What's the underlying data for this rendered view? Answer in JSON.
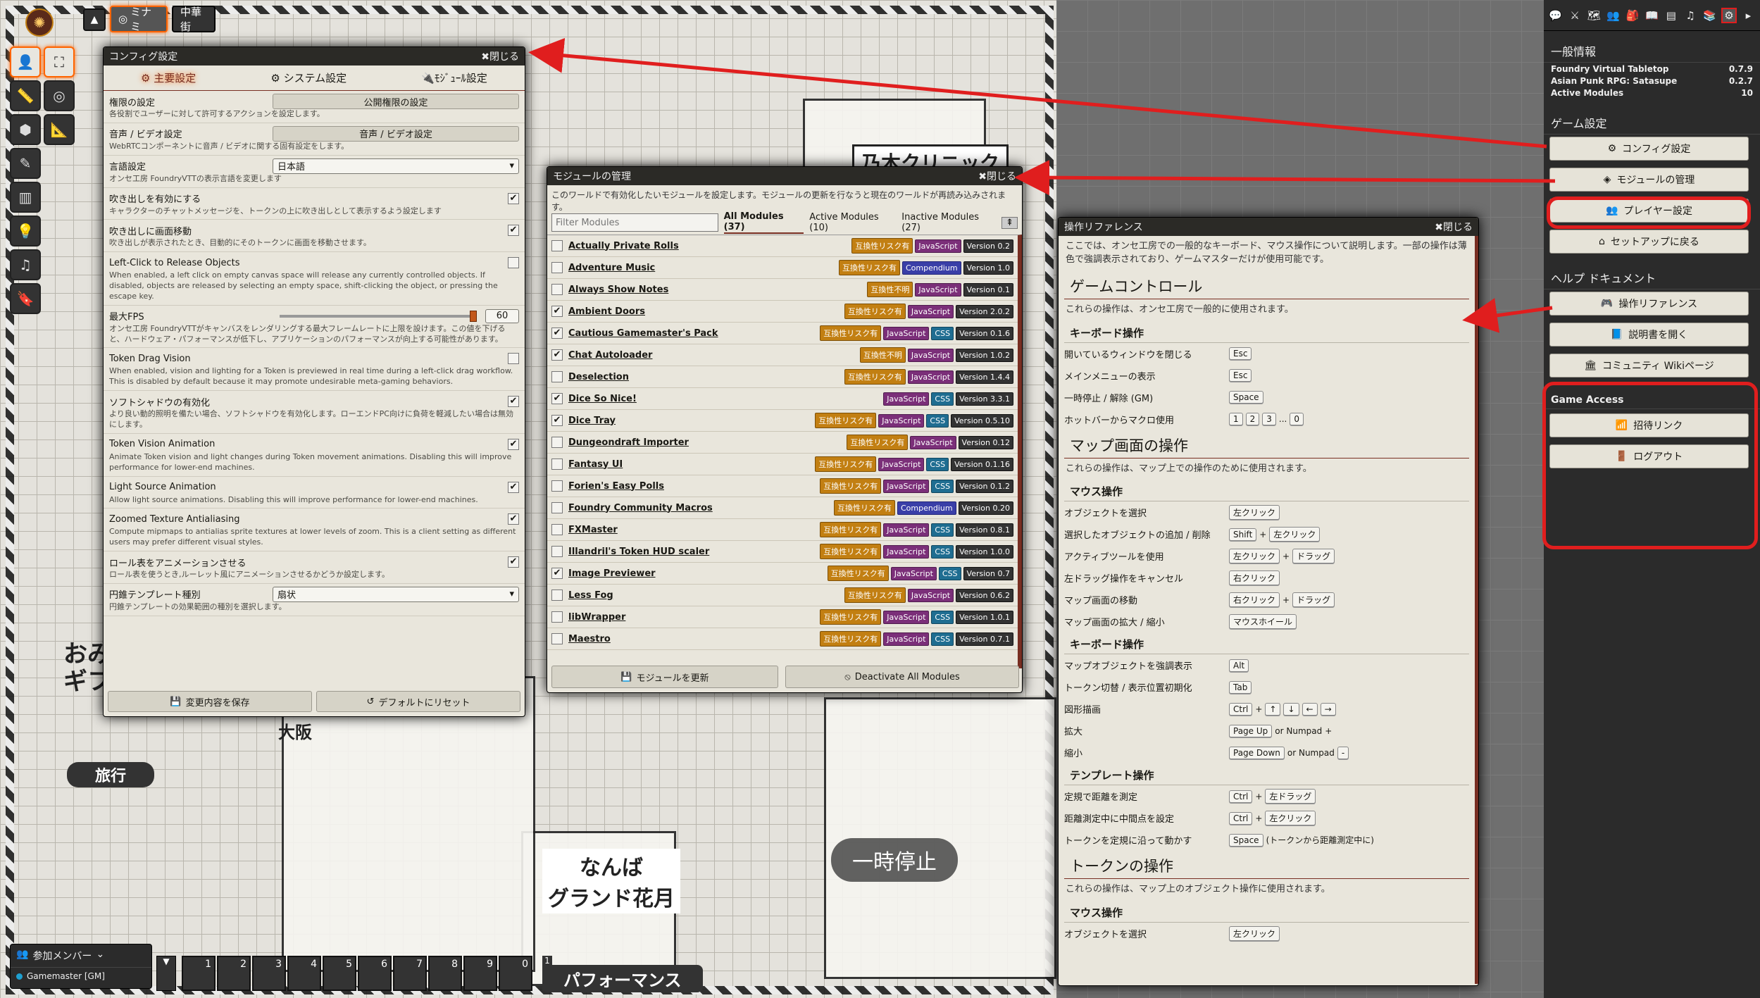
{
  "scene_nav": {
    "active_scene": "ミナミ",
    "other_scene": "中華街"
  },
  "map": {
    "labels": [
      "乃木クリニック",
      "なんば\nグランド花月",
      "旅行",
      "パフォーマンス",
      "大阪",
      "おみ\nギフ"
    ],
    "paused": "一時停止"
  },
  "config": {
    "title": "コンフィグ設定",
    "close": "閉じる",
    "tabs": [
      "主要設定",
      "システム設定",
      "ﾓｼﾞｭｰﾙ設定"
    ],
    "settings": [
      {
        "name": "権限の設定",
        "hint": "各役割でユーザーに対して許可するアクションを設定します。",
        "control": "button",
        "value": "公開権限の設定"
      },
      {
        "name": "音声 / ビデオ設定",
        "hint": "WebRTCコンポーネントに音声 / ビデオに関する固有設定をします。",
        "control": "button",
        "value": "音声 / ビデオ設定"
      },
      {
        "name": "言語設定",
        "hint": "オンセ工房 FoundryVTTの表示言語を変更します",
        "control": "select",
        "value": "日本語"
      },
      {
        "name": "吹き出しを有効にする",
        "hint": "キャラクターのチャットメッセージを、トークンの上に吹き出しとして表示するよう設定します",
        "control": "check",
        "checked": true
      },
      {
        "name": "吹き出しに画面移動",
        "hint": "吹き出しが表示されたとき、目動的にそのトークンに画面を移動させます。",
        "control": "check",
        "checked": true
      },
      {
        "name": "Left-Click to Release Objects",
        "hint": "When enabled, a left click on empty canvas space will release any currently controlled objects. If disabled, objects are released by selecting an empty space, shift-clicking the object, or pressing the escape key.",
        "control": "check",
        "checked": false
      },
      {
        "name": "最大FPS",
        "hint": "オンセ工房 FoundryVTTがキャンバスをレンダリングする最大フレームレートに上限を設けます。この値を下げると、ハードウェア・パフォーマンスが低下し、アプリケーションのパフォーマンスが向上する可能性があります。",
        "control": "range",
        "value": "60",
        "fraction": 1.0
      },
      {
        "name": "Token Drag Vision",
        "hint": "When enabled, vision and lighting for a Token is previewed in real time during a left-click drag workflow. This is disabled by default because it may promote undesirable meta-gaming behaviors.",
        "control": "check",
        "checked": false
      },
      {
        "name": "ソフトシャドウの有効化",
        "hint": "より良い動的照明を備たい場合、ソフトシャドウを有効化します。ローエンドPC向けに負荷を軽減したい場合は無効にします。",
        "control": "check",
        "checked": true
      },
      {
        "name": "Token Vision Animation",
        "hint": "Animate Token vision and light changes during Token movement animations. Disabling this will improve performance for lower-end machines.",
        "control": "check",
        "checked": true
      },
      {
        "name": "Light Source Animation",
        "hint": "Allow light source animations. Disabling this will improve performance for lower-end machines.",
        "control": "check",
        "checked": true
      },
      {
        "name": "Zoomed Texture Antialiasing",
        "hint": "Compute mipmaps to antialias sprite textures at lower levels of zoom. This is a client setting as different users may prefer different visual styles.",
        "control": "check",
        "checked": true
      },
      {
        "name": "ロール表をアニメーションさせる",
        "hint": "ロール表を使うとき,ルーレット風にアニメーションさせるかどうか設定します。",
        "control": "check",
        "checked": true
      },
      {
        "name": "円錐テンプレート種別",
        "hint": "円錐テンプレートの効果範囲の種別を選択します。",
        "control": "select",
        "value": "扇状"
      }
    ],
    "save": "変更内容を保存",
    "reset": "デフォルトにリセット"
  },
  "modules": {
    "title": "モジュールの管理",
    "close": "閉じる",
    "intro": "このワールドで有効化したいモジュールを設定します。モジュールの更新を行なうと現在のワールドが再読み込みされます。",
    "filter_placeholder": "Filter Modules",
    "tabs": [
      "All Modules (37)",
      "Active Modules (10)",
      "Inactive Modules (27)"
    ],
    "items": [
      {
        "name": "Actually Private Rolls",
        "checked": false,
        "tags": [
          "互換性リスク有",
          "JavaScript"
        ],
        "version": "Version 0.2"
      },
      {
        "name": "Adventure Music",
        "checked": false,
        "tags": [
          "互換性リスク有",
          "Compendium"
        ],
        "version": "Version 1.0"
      },
      {
        "name": "Always Show Notes",
        "checked": false,
        "tags": [
          "互換性不明",
          "JavaScript"
        ],
        "version": "Version 0.1"
      },
      {
        "name": "Ambient Doors",
        "checked": true,
        "tags": [
          "互換性リスク有",
          "JavaScript"
        ],
        "version": "Version 2.0.2"
      },
      {
        "name": "Cautious Gamemaster's Pack",
        "checked": true,
        "tags": [
          "互換性リスク有",
          "JavaScript",
          "CSS"
        ],
        "version": "Version 0.1.6"
      },
      {
        "name": "Chat Autoloader",
        "checked": true,
        "tags": [
          "互換性不明",
          "JavaScript"
        ],
        "version": "Version 1.0.2"
      },
      {
        "name": "Deselection",
        "checked": false,
        "tags": [
          "互換性リスク有",
          "JavaScript"
        ],
        "version": "Version 1.4.4"
      },
      {
        "name": "Dice So Nice!",
        "checked": true,
        "tags": [
          "JavaScript",
          "CSS"
        ],
        "version": "Version 3.3.1"
      },
      {
        "name": "Dice Tray",
        "checked": true,
        "tags": [
          "互換性リスク有",
          "JavaScript",
          "CSS"
        ],
        "version": "Version 0.5.10"
      },
      {
        "name": "Dungeondraft Importer",
        "checked": false,
        "tags": [
          "互換性リスク有",
          "JavaScript"
        ],
        "version": "Version 0.12"
      },
      {
        "name": "Fantasy UI",
        "checked": false,
        "tags": [
          "互換性リスク有",
          "JavaScript",
          "CSS"
        ],
        "version": "Version 0.1.16"
      },
      {
        "name": "Forien's Easy Polls",
        "checked": false,
        "tags": [
          "互換性リスク有",
          "JavaScript",
          "CSS"
        ],
        "version": "Version 0.1.2"
      },
      {
        "name": "Foundry Community Macros",
        "checked": false,
        "tags": [
          "互換性リスク有",
          "Compendium"
        ],
        "version": "Version 0.20"
      },
      {
        "name": "FXMaster",
        "checked": false,
        "tags": [
          "互換性リスク有",
          "JavaScript",
          "CSS"
        ],
        "version": "Version 0.8.1"
      },
      {
        "name": "Illandril's Token HUD scaler",
        "checked": false,
        "tags": [
          "互換性リスク有",
          "JavaScript",
          "CSS"
        ],
        "version": "Version 1.0.0"
      },
      {
        "name": "Image Previewer",
        "checked": true,
        "tags": [
          "互換性リスク有",
          "JavaScript",
          "CSS"
        ],
        "version": "Version 0.7"
      },
      {
        "name": "Less Fog",
        "checked": false,
        "tags": [
          "互換性リスク有",
          "JavaScript"
        ],
        "version": "Version 0.6.2"
      },
      {
        "name": "libWrapper",
        "checked": false,
        "tags": [
          "互換性リスク有",
          "JavaScript",
          "CSS"
        ],
        "version": "Version 1.0.1"
      },
      {
        "name": "Maestro",
        "checked": false,
        "tags": [
          "互換性リスク有",
          "JavaScript",
          "CSS"
        ],
        "version": "Version 0.7.1"
      }
    ],
    "update": "モジュールを更新",
    "deactivate": "Deactivate All Modules"
  },
  "reference": {
    "title": "操作リファレンス",
    "close": "閉じる",
    "intro": "ここでは、オンセ工房での一般的なキーボード、マウス操作について説明します。一部の操作は薄色で強調表示されており、ゲームマスターだけが使用可能です。",
    "sections": [
      {
        "title": "ゲームコントロール",
        "desc": "これらの操作は、オンセ工房で一般的に使用されます。",
        "groups": [
          {
            "title": "キーボード操作",
            "rows": [
              {
                "label": "開いているウィンドウを閉じる",
                "keys": [
                  "Esc"
                ]
              },
              {
                "label": "メインメニューの表示",
                "keys": [
                  "Esc"
                ]
              },
              {
                "label": "一時停止 / 解除 (GM)",
                "keys": [
                  "Space"
                ]
              },
              {
                "label": "ホットバーからマクロ使用",
                "keys": [
                  "1",
                  "2",
                  "3",
                  "...",
                  "0"
                ]
              }
            ]
          }
        ]
      },
      {
        "title": "マップ画面の操作",
        "desc": "これらの操作は、マップ上での操作のために使用されます。",
        "groups": [
          {
            "title": "マウス操作",
            "rows": [
              {
                "label": "オブジェクトを選択",
                "keys": [
                  "左クリック"
                ]
              },
              {
                "label": "選択したオブジェクトの追加 / 削除",
                "keys": [
                  "Shift",
                  "+",
                  "左クリック"
                ]
              },
              {
                "label": "アクティブツールを使用",
                "keys": [
                  "左クリック",
                  "+",
                  "ドラッグ"
                ]
              },
              {
                "label": "左ドラッグ操作をキャンセル",
                "keys": [
                  "右クリック"
                ]
              },
              {
                "label": "マップ画面の移動",
                "keys": [
                  "右クリック",
                  "+",
                  "ドラッグ"
                ]
              },
              {
                "label": "マップ画面の拡大 / 縮小",
                "keys": [
                  "マウスホイール"
                ]
              }
            ]
          },
          {
            "title": "キーボード操作",
            "rows": [
              {
                "label": "マップオブジェクトを強調表示",
                "keys": [
                  "Alt"
                ]
              },
              {
                "label": "トークン切替 / 表示位置初期化",
                "keys": [
                  "Tab"
                ]
              },
              {
                "label": "図形描画",
                "keys": [
                  "Ctrl",
                  "+",
                  "↑",
                  "↓",
                  "←",
                  "→"
                ]
              },
              {
                "label": "拡大",
                "keys": [
                  "Page Up",
                  "or Numpad",
                  "+"
                ]
              },
              {
                "label": "縮小",
                "keys": [
                  "Page Down",
                  "or Numpad",
                  "-"
                ]
              }
            ]
          },
          {
            "title": "テンプレート操作",
            "rows": [
              {
                "label": "定規で距離を測定",
                "keys": [
                  "Ctrl",
                  "+",
                  "左ドラッグ"
                ]
              },
              {
                "label": "距離測定中に中間点を設定",
                "keys": [
                  "Ctrl",
                  "+",
                  "左クリック"
                ]
              },
              {
                "label": "トークンを定規に沿って動かす",
                "keys": [
                  "Space",
                  "(トークンから距離測定中に)"
                ]
              }
            ]
          }
        ]
      },
      {
        "title": "トークンの操作",
        "desc": "これらの操作は、マップ上のオブジェクト操作に使用されます。",
        "groups": [
          {
            "title": "マウス操作",
            "rows": [
              {
                "label": "オブジェクトを選択",
                "keys": [
                  "左クリック"
                ]
              }
            ]
          }
        ]
      }
    ]
  },
  "sidebar": {
    "general_title": "一般情報",
    "info": [
      {
        "label": "Foundry Virtual Tabletop",
        "value": "0.7.9"
      },
      {
        "label": "Asian Punk RPG: Satasupe",
        "value": "0.2.7"
      },
      {
        "label": "Active Modules",
        "value": "10"
      }
    ],
    "game_settings_title": "ゲーム設定",
    "config_btn": "コンフィグ設定",
    "modules_btn": "モジュールの管理",
    "players_btn": "プレイヤー設定",
    "setup_btn": "セットアップに戻る",
    "help_title": "ヘルプ ドキュメント",
    "ref_btn": "操作リファレンス",
    "manual_btn": "説明書を開く",
    "wiki_btn": "コミュニティ Wikiページ",
    "access_title": "Game Access",
    "invite_btn": "招待リンク",
    "logout_btn": "ログアウト"
  },
  "players": {
    "title": "参加メンバー",
    "user": "Gamemaster [GM]"
  },
  "hotbar": {
    "slots": [
      "1",
      "2",
      "3",
      "4",
      "5",
      "6",
      "7",
      "8",
      "9",
      "0"
    ],
    "page": "1"
  },
  "colors": {
    "accent": "#ff6400",
    "highlight": "#e01e1e",
    "sheet": "#e9e6dc"
  }
}
